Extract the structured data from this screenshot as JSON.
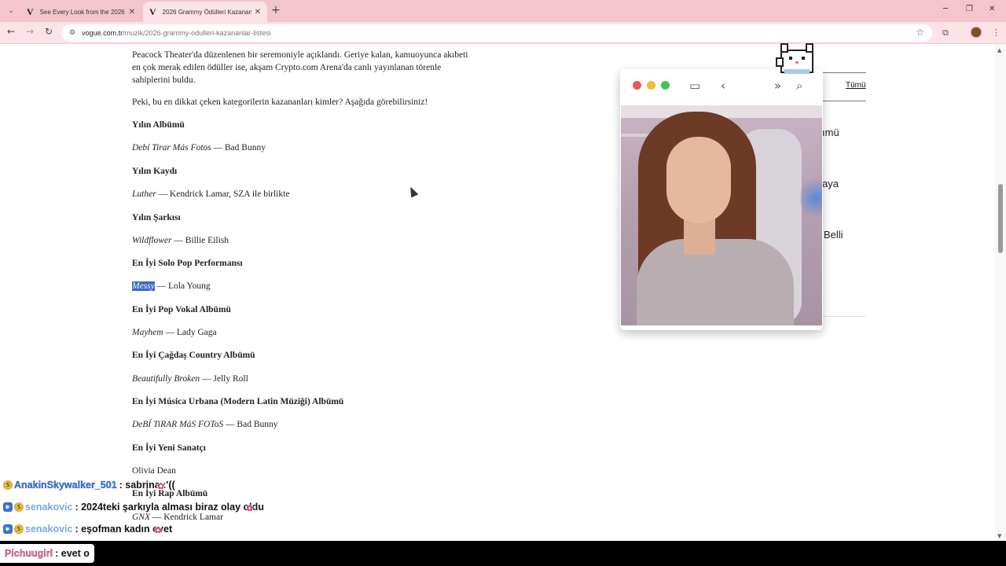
{
  "browser": {
    "tabs": [
      {
        "title": "See Every Look from the 2026 G",
        "favicon": "V",
        "active": false
      },
      {
        "title": "2026 Grammy Ödülleri Kazanan",
        "favicon": "V",
        "active": true
      }
    ],
    "url_domain": "vogue.com.tr",
    "url_path": "/muzik/2026-grammy-odulleri-kazananlar-listesi"
  },
  "article": {
    "intro_lines": [
      "Peacock Theater'da düzenlenen bir seremoniyle açıklandı. Geriye kalan, kamuoyunca akıbeti",
      "en çok merak edilen ödüller ise, akşam Crypto.com Arena'da canlı yayınlanan törenle",
      "sahiplerini buldu."
    ],
    "question": "Peki, bu en dikkat çeken kategorilerin kazananları kimler? Aşağıda görebilirsiniz!",
    "categories": [
      {
        "heading": "Yılın Albümü",
        "work": "Debí Tirar Más Fotos",
        "artist": " — Bad Bunny"
      },
      {
        "heading": "Yılın Kaydı",
        "work": "Luther",
        "artist": " — Kendrick Lamar, SZA ile birlikte"
      },
      {
        "heading": "Yılın Şarkısı",
        "work": "Wildflower",
        "artist": " — Billie Eilish"
      },
      {
        "heading": "En İyi Solo Pop Performansı",
        "work": "Messy",
        "artist": " — Lola Young"
      },
      {
        "heading": "En İyi Pop Vokal Albümü",
        "work": "Mayhem",
        "artist": " — Lady Gaga"
      },
      {
        "heading": "En İyi Çağdaş Country Albümü",
        "work": "Beautifully Broken",
        "artist": " — Jelly Roll"
      },
      {
        "heading": "En İyi Música Urbana (Modern Latin Müziği) Albümü",
        "work": "DeBÍ TiRAR MáS FOToS",
        "artist": " — Bad Bunny"
      },
      {
        "heading": "En İyi Yeni Sanatçı",
        "work": "",
        "artist": "Olivia Dean"
      },
      {
        "heading": "En İyi Rap Albümü",
        "work": "GNX",
        "artist": " — Kendrick Lamar"
      }
    ]
  },
  "sidebar": {
    "tumu": "Tümü",
    "frag1": "ımü",
    "frag2": "aya",
    "frag3": "Belli"
  },
  "chat": [
    {
      "user": "AnakinSkywalker_501",
      "text": ": sabrina :'((",
      "style": "blue"
    },
    {
      "user": "senakovic",
      "text": ": 2024teki şarkıyla alması biraz olay oldu",
      "style": "sena"
    },
    {
      "user": "senakovic",
      "text": ": eşofman kadın evet",
      "style": "sena"
    },
    {
      "user": "Pichuugirl",
      "text": ": evet o",
      "style": "pink"
    }
  ],
  "colors": {
    "tabbar": "#f4c5cd",
    "toolbar": "#fbe3e7",
    "highlight": "#3867c8"
  }
}
